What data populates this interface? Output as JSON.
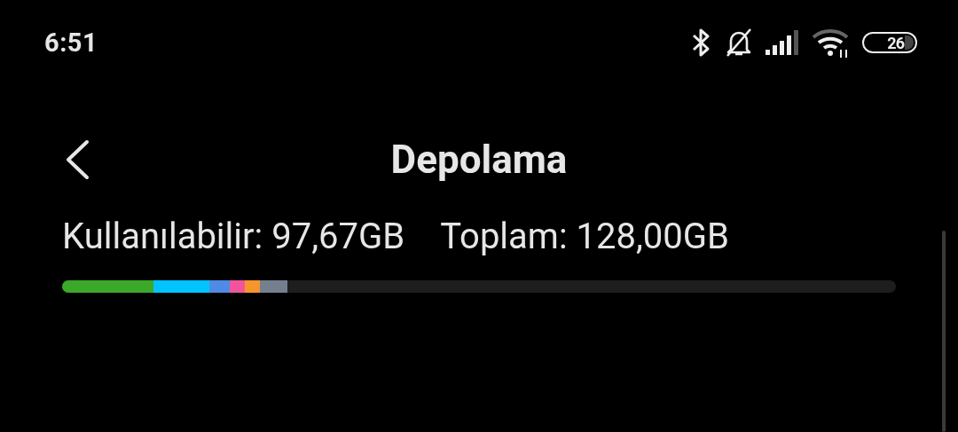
{
  "status_bar": {
    "time": "6:51",
    "battery": "26"
  },
  "header": {
    "title": "Depolama"
  },
  "storage": {
    "available_label": "Kullanılabilir: 97,67GB",
    "total_label": "Toplam: 128,00GB",
    "segments": [
      {
        "color": "#3ba82a"
      },
      {
        "color": "#00c3ff"
      },
      {
        "color": "#4f8be6"
      },
      {
        "color": "#f0559c"
      },
      {
        "color": "#f5952c"
      },
      {
        "color": "#74808f"
      }
    ]
  }
}
